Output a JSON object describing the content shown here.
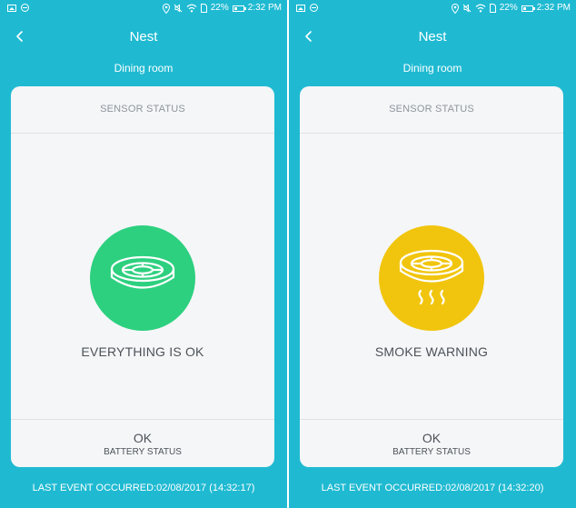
{
  "status_bar": {
    "battery_percent": "22%",
    "time": "2:32 PM"
  },
  "screens": [
    {
      "title": "Nest",
      "room": "Dining room",
      "section_title": "SENSOR STATUS",
      "status_text": "EVERYTHING IS OK",
      "status_color": "#2dd07f",
      "status_icon": "smoke-detector-icon",
      "battery_value": "OK",
      "battery_label": "BATTERY STATUS",
      "last_event": "LAST EVENT OCCURRED:02/08/2017 (14:32:17)"
    },
    {
      "title": "Nest",
      "room": "Dining room",
      "section_title": "SENSOR STATUS",
      "status_text": "SMOKE WARNING",
      "status_color": "#f1c50e",
      "status_icon": "smoke-detector-smoke-icon",
      "battery_value": "OK",
      "battery_label": "BATTERY STATUS",
      "last_event": "LAST EVENT OCCURRED:02/08/2017 (14:32:20)"
    }
  ],
  "colors": {
    "background": "#1fbad2",
    "card": "#f5f6f8"
  }
}
